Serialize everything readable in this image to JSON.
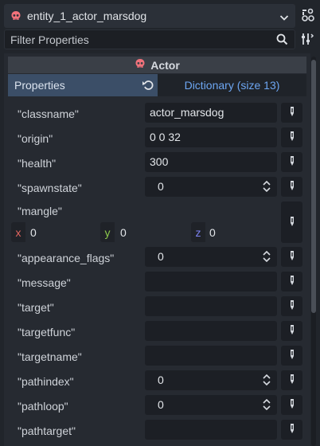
{
  "node_selector": {
    "title": "entity_1_actor_marsdog",
    "icon": "skull-icon",
    "dropdown_icon": "chevron-down-icon"
  },
  "help_icon": "object-help-icon",
  "filter": {
    "placeholder": "Filter Properties",
    "search_icon": "search-icon",
    "tools_icon": "property-tools-icon"
  },
  "section": {
    "title": "Actor",
    "icon": "skull-icon"
  },
  "tabs": {
    "properties": "Properties",
    "dictionary": "Dictionary (size 13)",
    "revert_icon": "revert-icon"
  },
  "properties": [
    {
      "key": "\"classname\"",
      "value": "actor_marsdog",
      "kind": "text"
    },
    {
      "key": "\"origin\"",
      "value": "0 0 32",
      "kind": "text"
    },
    {
      "key": "\"health\"",
      "value": "300",
      "kind": "text"
    },
    {
      "key": "\"spawnstate\"",
      "value": "0",
      "kind": "int"
    },
    {
      "key": "\"mangle\"",
      "kind": "vector3",
      "x_label": "x",
      "x": "0",
      "y_label": "y",
      "y": "0",
      "z_label": "z",
      "z": "0"
    },
    {
      "key": "\"appearance_flags\"",
      "value": "0",
      "kind": "int"
    },
    {
      "key": "\"message\"",
      "value": "",
      "kind": "text"
    },
    {
      "key": "\"target\"",
      "value": "",
      "kind": "text"
    },
    {
      "key": "\"targetfunc\"",
      "value": "",
      "kind": "text"
    },
    {
      "key": "\"targetname\"",
      "value": "",
      "kind": "text"
    },
    {
      "key": "\"pathindex\"",
      "value": "0",
      "kind": "int"
    },
    {
      "key": "\"pathloop\"",
      "value": "0",
      "kind": "int"
    },
    {
      "key": "\"pathtarget\"",
      "value": "",
      "kind": "text"
    }
  ],
  "edit_icon": "pencil-icon",
  "colors": {
    "accent": "#3b4e67",
    "dictionary_link": "#6da6f2",
    "axis_x": "#e0655f",
    "axis_y": "#8cc84b",
    "axis_z": "#7c82f2",
    "skull": "#f2727b"
  }
}
